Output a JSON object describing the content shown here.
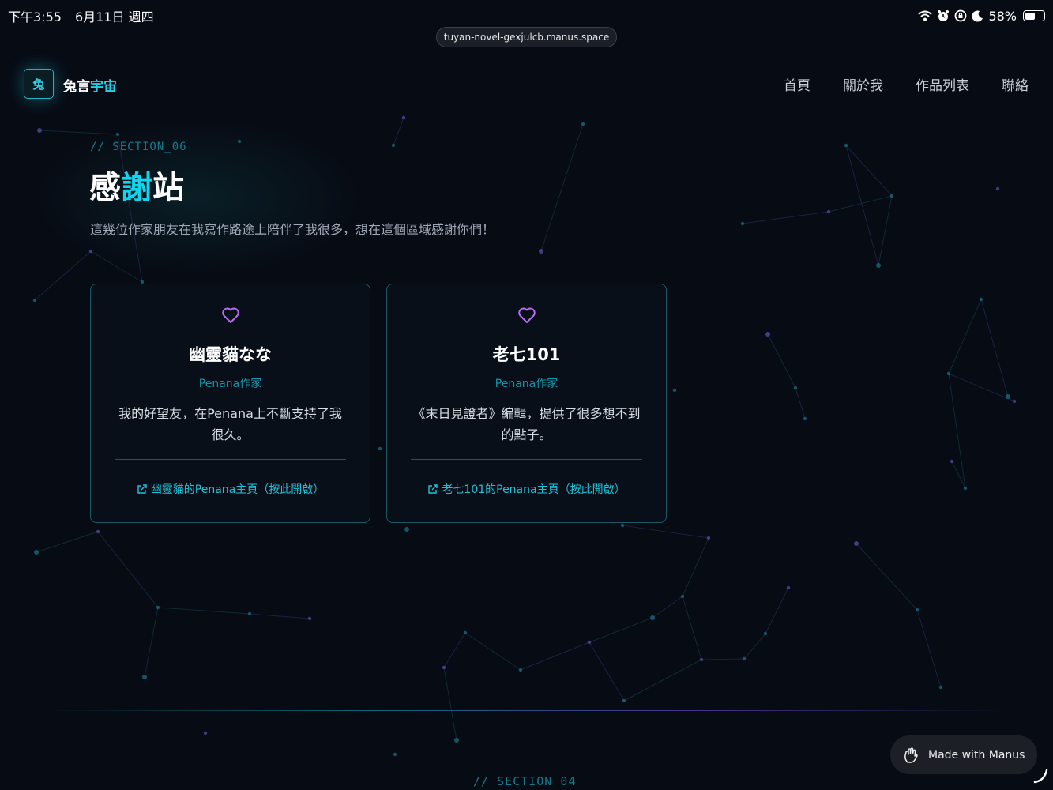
{
  "status_bar": {
    "time": "下午3:55",
    "date": "6月11日 週四",
    "battery": "58%",
    "battery_level": 0.58
  },
  "browser": {
    "url": "tuyan-novel-gexjulcb.manus.space"
  },
  "header": {
    "logo_icon_text": "兔",
    "logo_text_white": "兔言",
    "logo_text_cyan": "宇宙",
    "nav": [
      "首頁",
      "關於我",
      "作品列表",
      "聯絡"
    ]
  },
  "section": {
    "tag": "// SECTION_06",
    "title_a": "感",
    "title_accent": "謝",
    "title_b": "站",
    "description": "這幾位作家朋友在我寫作路途上陪伴了我很多，想在這個區域感謝你們！"
  },
  "cards": [
    {
      "name": "幽靈貓なな",
      "role": "Penana作家",
      "description": "我的好望友，在Penana上不斷支持了我很久。",
      "link": "幽靈貓的Penana主頁（按此開啟）"
    },
    {
      "name": "老七101",
      "role": "Penana作家",
      "description": "《末日見證者》編輯，提供了很多想不到的點子。",
      "link": "老七101的Penana主頁（按此開啟）"
    }
  ],
  "next_section": {
    "tag": "// SECTION_04"
  },
  "badge": {
    "label": "Made with Manus"
  },
  "colors": {
    "background": "#070b14",
    "accent_cyan": "#14d3ec",
    "heart_purple": "#b56cf0",
    "card_border": "#1a5a66"
  },
  "icons": [
    "wifi-icon",
    "alarm-icon",
    "lock-rotation-icon",
    "moon-icon",
    "battery-icon",
    "heart-icon",
    "external-link-icon",
    "manus-hand-icon"
  ]
}
